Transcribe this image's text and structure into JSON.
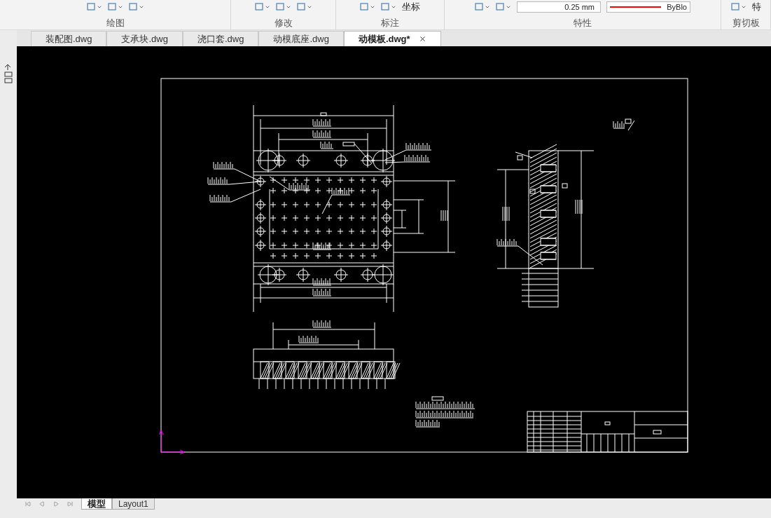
{
  "ribbon": {
    "panels": [
      {
        "label": "绘图"
      },
      {
        "label": "修改"
      },
      {
        "label": "标注",
        "button": "坐标"
      },
      {
        "label": "特性",
        "lineweight": "0.25 mm",
        "color_value": "ByBlo"
      },
      {
        "label": "剪切板",
        "button": "特"
      }
    ]
  },
  "document_tabs": [
    {
      "label": "装配图.dwg",
      "selected": false
    },
    {
      "label": "支承块.dwg",
      "selected": false
    },
    {
      "label": "浇口套.dwg",
      "selected": false
    },
    {
      "label": "动模底座.dwg",
      "selected": false
    },
    {
      "label": "动模板.dwg*",
      "selected": true
    }
  ],
  "layout_tabs": [
    {
      "label": "模型",
      "selected": true
    },
    {
      "label": "Layout1",
      "selected": false
    }
  ]
}
